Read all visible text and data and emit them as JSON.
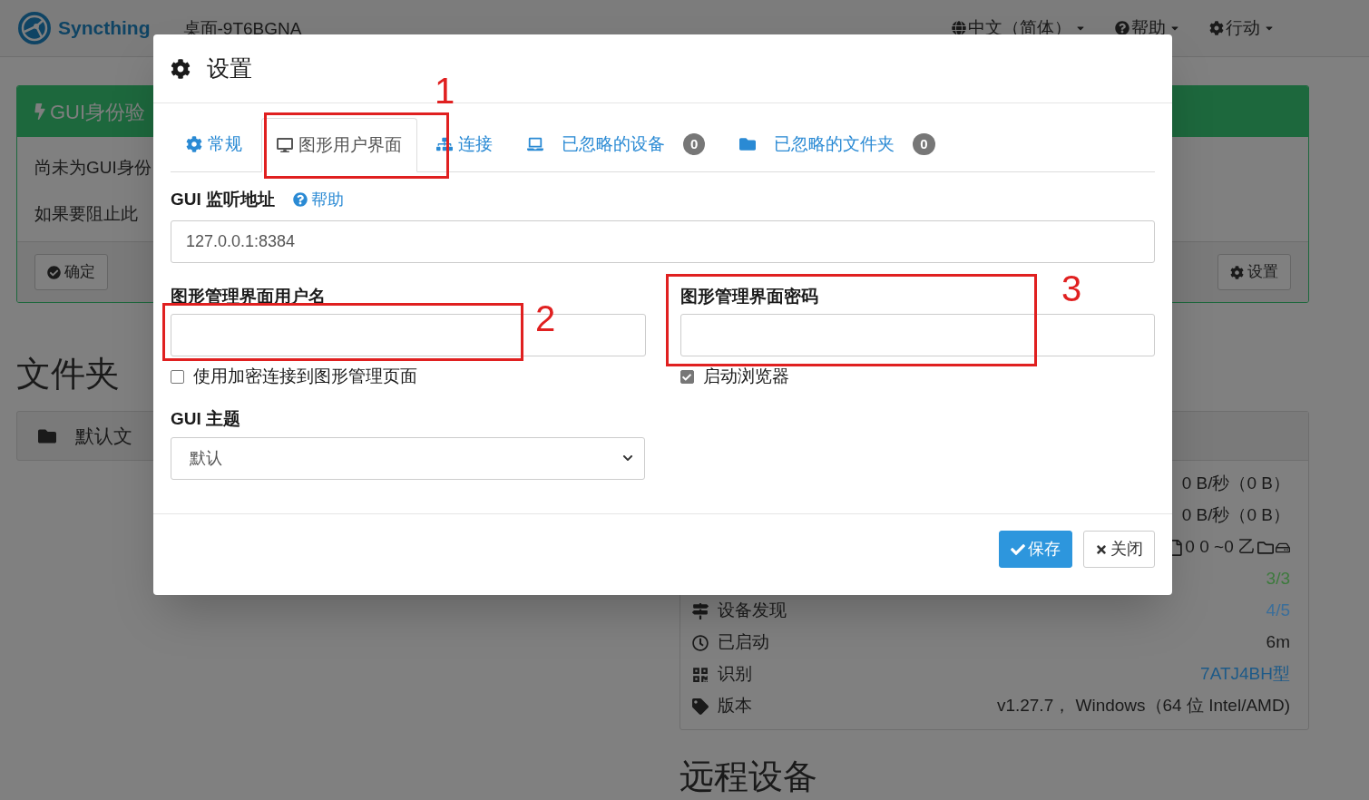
{
  "navbar": {
    "brand": "Syncthing",
    "device_name": "桌面-9T6BGNA",
    "menus": [
      {
        "label": "中文（简体）"
      },
      {
        "label": "帮助"
      },
      {
        "label": "行动"
      }
    ]
  },
  "notice": {
    "title": "GUI身份验",
    "lines": [
      "尚未为GUI身份",
      "如果要阻止此"
    ],
    "buttons": [
      {
        "label": "确定"
      },
      {
        "label": "设置"
      }
    ]
  },
  "folders": {
    "heading": "文件夹",
    "items": [
      "默认文"
    ]
  },
  "this_device": {
    "rows": [
      {
        "kind": "value",
        "value": "0 B/秒（0 B）",
        "color": "#1a1a1a"
      },
      {
        "kind": "value",
        "value": "0 B/秒（0 B）",
        "color": "#1a1a1a"
      },
      {
        "kind": "usage",
        "value": "0 0 ~0 乙",
        "color": "#1a1a1a"
      },
      {
        "kind": "value",
        "value": "3/3",
        "color": "#3d7a3d"
      },
      {
        "kind": "labeled",
        "label": "设备发现",
        "value": "4/5",
        "color": "#3a6e9a"
      },
      {
        "kind": "labeled",
        "label": "已启动",
        "value": "6m",
        "color": "#1a1a1a"
      },
      {
        "kind": "labeled",
        "label": "识别",
        "value": "7ATJ4BH型",
        "color": "#1d5a88"
      },
      {
        "kind": "labeled",
        "label": "版本",
        "value": "v1.27.7， Windows（64 位 Intel/AMD)",
        "color": "#1a1a1a"
      }
    ]
  },
  "remote_devices": {
    "heading": "远程设备"
  },
  "modal": {
    "title": "设置",
    "tabs": [
      {
        "label": "常规",
        "selected": false
      },
      {
        "label": "图形用户界面",
        "selected": true
      },
      {
        "label": "连接",
        "selected": false
      },
      {
        "label": "已忽略的设备",
        "badge": "0",
        "selected": false
      },
      {
        "label": "已忽略的文件夹",
        "badge": "0",
        "selected": false
      }
    ],
    "address": {
      "label": "GUI 监听地址",
      "help": "帮助",
      "value": "127.0.0.1:8384"
    },
    "username": {
      "label": "图形管理界面用户名"
    },
    "password": {
      "label": "图形管理界面密码"
    },
    "checkboxes": [
      {
        "label": "使用加密连接到图形管理页面",
        "checked": false
      },
      {
        "label": "启动浏览器",
        "checked": true
      }
    ],
    "theme": {
      "label": "GUI 主题",
      "value": "默认"
    },
    "buttons": [
      {
        "label": "保存",
        "kind": "primary"
      },
      {
        "label": "关闭",
        "kind": "default"
      }
    ]
  },
  "annotations": [
    {
      "number": "1"
    },
    {
      "number": "2"
    },
    {
      "number": "3"
    }
  ]
}
